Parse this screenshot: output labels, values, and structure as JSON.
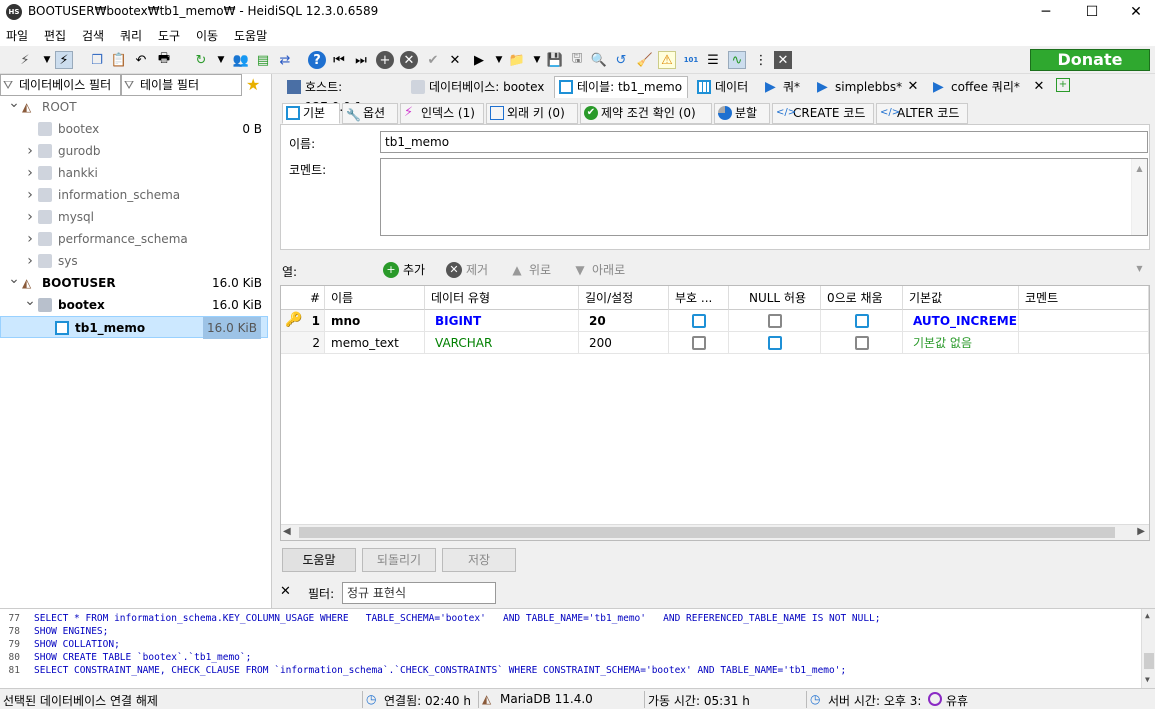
{
  "window": {
    "title": "BOOTUSER₩bootex₩tb1_memo₩ - HeidiSQL 12.3.0.6589",
    "app_icon": "HS",
    "minimize": "─",
    "maximize": "☐",
    "close": "✕"
  },
  "menu": [
    "파일",
    "편집",
    "검색",
    "쿼리",
    "도구",
    "이동",
    "도움말"
  ],
  "toolbar": {
    "donate": "Donate"
  },
  "left": {
    "db_filter": "데이터베이스 필터",
    "table_filter": "테이블 필터",
    "tree": [
      {
        "label": "ROOT",
        "size": "",
        "level": 0,
        "expanded": true,
        "bold": false,
        "gray": true
      },
      {
        "label": "bootex",
        "size": "0 B",
        "level": 1,
        "expanded": null,
        "bold": false,
        "gray": true
      },
      {
        "label": "gurodb",
        "size": "",
        "level": 1,
        "expanded": false,
        "bold": false,
        "gray": true
      },
      {
        "label": "hankki",
        "size": "",
        "level": 1,
        "expanded": false,
        "bold": false,
        "gray": true
      },
      {
        "label": "information_schema",
        "size": "",
        "level": 1,
        "expanded": false,
        "bold": false,
        "gray": true
      },
      {
        "label": "mysql",
        "size": "",
        "level": 1,
        "expanded": false,
        "bold": false,
        "gray": true
      },
      {
        "label": "performance_schema",
        "size": "",
        "level": 1,
        "expanded": false,
        "bold": false,
        "gray": true
      },
      {
        "label": "sys",
        "size": "",
        "level": 1,
        "expanded": false,
        "bold": false,
        "gray": true
      },
      {
        "label": "BOOTUSER",
        "size": "16.0 KiB",
        "level": 0,
        "expanded": true,
        "bold": true,
        "gray": false
      },
      {
        "label": "bootex",
        "size": "16.0 KiB",
        "level": 1,
        "expanded": true,
        "bold": true,
        "gray": false
      },
      {
        "label": "tb1_memo",
        "size": "16.0 KiB",
        "level": 2,
        "expanded": null,
        "bold": true,
        "gray": false,
        "selected": true
      }
    ]
  },
  "tabs": [
    {
      "label": "호스트: 127.0.0.1"
    },
    {
      "label": "데이터베이스: bootex"
    },
    {
      "label": "테이블: tb1_memo"
    },
    {
      "label": "데이터"
    },
    {
      "label": "쿼*"
    },
    {
      "label": "simplebbs*"
    },
    {
      "label": "coffee 쿼리*"
    }
  ],
  "subtabs": [
    "기본",
    "옵션",
    "인덱스 (1)",
    "외래 키 (0)",
    "제약 조건 확인 (0)",
    "분할",
    "CREATE 코드",
    "ALTER 코드"
  ],
  "form": {
    "name_label": "이름:",
    "name_value": "tb1_memo",
    "comment_label": "코멘트:"
  },
  "columns_toolbar": {
    "label": "열:",
    "add": "추가",
    "remove": "제거",
    "up": "위로",
    "down": "아래로"
  },
  "grid": {
    "headers": [
      "#",
      "이름",
      "데이터 유형",
      "길이/설정",
      "부호 ...",
      "NULL 허용",
      "0으로 채움",
      "기본값",
      "코멘트"
    ],
    "rows": [
      {
        "num": "1",
        "name": "mno",
        "type": "BIGINT",
        "length": "20",
        "unsigned": true,
        "nullable": false,
        "zerofill": true,
        "default": "AUTO_INCREME...",
        "comment": "",
        "key": true
      },
      {
        "num": "2",
        "name": "memo_text",
        "type": "VARCHAR",
        "length": "200",
        "unsigned": false,
        "nullable": true,
        "zerofill": false,
        "default": "기본값 없음",
        "comment": "",
        "key": false
      }
    ]
  },
  "buttons": {
    "help": "도움말",
    "revert": "되돌리기",
    "save": "저장"
  },
  "filter": {
    "label": "필터:",
    "placeholder": "정규 표현식"
  },
  "sqllog": [
    {
      "num": "77",
      "text": "SELECT * FROM information_schema.KEY_COLUMN_USAGE WHERE   TABLE_SCHEMA='bootex'   AND TABLE_NAME='tb1_memo'   AND REFERENCED_TABLE_NAME IS NOT NULL;"
    },
    {
      "num": "78",
      "text": "SHOW ENGINES;"
    },
    {
      "num": "79",
      "text": "SHOW COLLATION;"
    },
    {
      "num": "80",
      "text": "SHOW CREATE TABLE `bootex`.`tb1_memo`;"
    },
    {
      "num": "81",
      "text": "SELECT CONSTRAINT_NAME, CHECK_CLAUSE FROM `information_schema`.`CHECK_CONSTRAINTS` WHERE CONSTRAINT_SCHEMA='bootex' AND TABLE_NAME='tb1_memo';"
    }
  ],
  "status": {
    "left": "선택된 데이터베이스 연결 해제",
    "connected": "연결됨: 02:40 h",
    "server": "MariaDB 11.4.0",
    "uptime": "가동 시간: 05:31 h",
    "server_time": "서버 시간: 오후 3:",
    "idle": "유휴"
  },
  "colors": {
    "accent": "#1e90d6",
    "donate": "#2fa82f",
    "selected": "#cce8ff",
    "type_int": "#0000ff",
    "type_varchar": "#008000"
  }
}
